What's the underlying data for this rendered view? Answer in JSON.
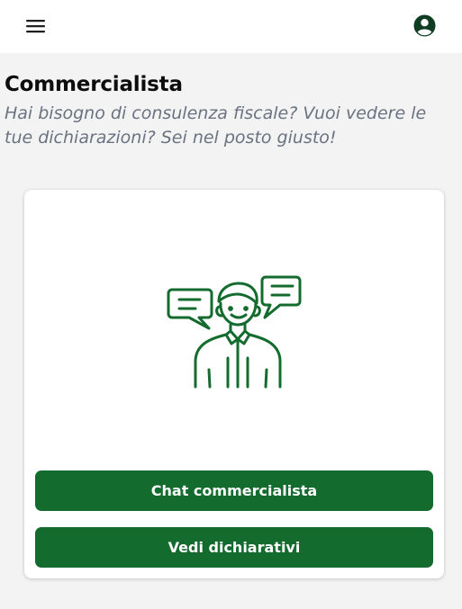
{
  "header": {
    "menu_icon": "hamburger-menu-icon",
    "account_icon": "account-circle-icon"
  },
  "page": {
    "title": "Commercialista",
    "subtitle": "Hai bisogno di consulenza fiscale? Vuoi vedere le tue dichiarazioni? Sei nel posto giusto!"
  },
  "card": {
    "illustration_icon": "consultant-with-speech-bubbles-icon",
    "chat_button_label": "Chat commercialista",
    "dichiarativi_button_label": "Vedi dichiarativi"
  },
  "colors": {
    "brand_green": "#146b2e",
    "icon_dark": "#0f3d24",
    "background": "#f3f3f4"
  }
}
